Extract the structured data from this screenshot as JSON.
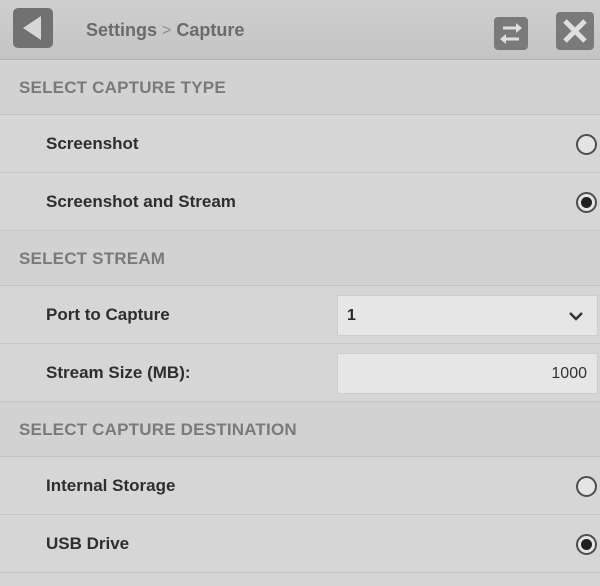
{
  "header": {
    "breadcrumb": [
      "Settings",
      "Capture"
    ],
    "separator": ">"
  },
  "capture_type": {
    "title": "SELECT CAPTURE TYPE",
    "options": [
      {
        "label": "Screenshot",
        "checked": false
      },
      {
        "label": "Screenshot and Stream",
        "checked": true
      }
    ]
  },
  "stream": {
    "title": "SELECT STREAM",
    "port_label": "Port to Capture",
    "port_value": "1",
    "size_label": "Stream Size (MB):",
    "size_value": "1000"
  },
  "destination": {
    "title": "SELECT CAPTURE DESTINATION",
    "options": [
      {
        "label": "Internal Storage",
        "checked": false
      },
      {
        "label": "USB Drive",
        "checked": true
      }
    ]
  },
  "icons": {
    "back": "back-arrow-icon",
    "swap": "swap-arrows-icon",
    "close": "close-icon",
    "dropdown": "chevron-down-icon"
  }
}
